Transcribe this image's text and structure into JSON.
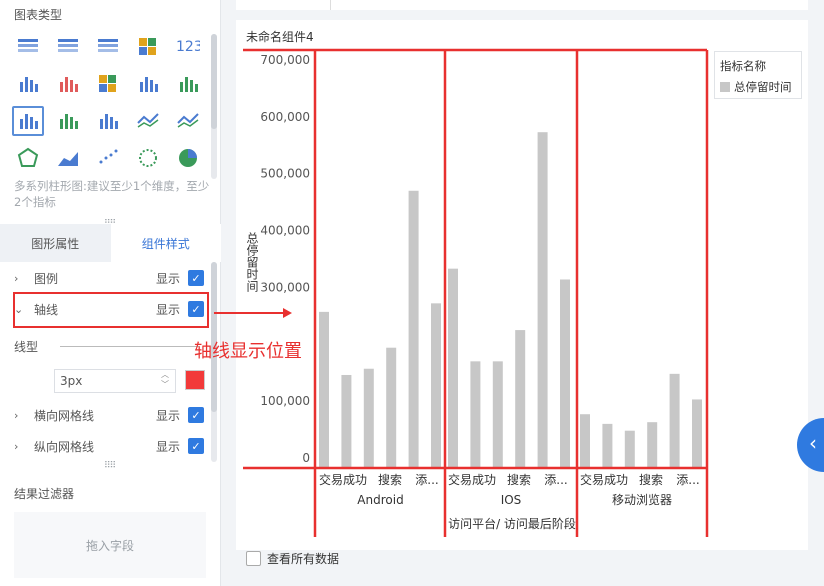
{
  "left": {
    "section_title": "图表类型",
    "chart_types": [
      {
        "name": "table-icon",
        "color": "#4a7bd0"
      },
      {
        "name": "group-table-icon",
        "color": "#4a7bd0"
      },
      {
        "name": "cross-table-icon",
        "color": "#4a7bd0"
      },
      {
        "name": "color-block-icon",
        "color": "#e0a31c"
      },
      {
        "name": "kpi-number-icon",
        "color": "#4a7bd0"
      },
      {
        "name": "multi-kpi-icon",
        "color": "#4a7bd0"
      },
      {
        "name": "kpi-grid-icon",
        "color": "#e05b5b"
      },
      {
        "name": "heatmap-icon",
        "color": "#e0a31c"
      },
      {
        "name": "stacked-bar-icon",
        "color": "#4a7bd0"
      },
      {
        "name": "bar-chart-icon",
        "color": "#3a9a5a"
      },
      {
        "name": "multi-series-bar-icon",
        "color": "#4a7bd0"
      },
      {
        "name": "horizontal-bar-icon",
        "color": "#3a9a5a"
      },
      {
        "name": "step-bar-icon",
        "color": "#4a7bd0"
      },
      {
        "name": "multi-line-icon",
        "color": "#4a7bd0"
      },
      {
        "name": "combo-line-icon",
        "color": "#4a7bd0"
      },
      {
        "name": "radar-icon",
        "color": "#3a9a5a"
      },
      {
        "name": "area-icon",
        "color": "#4a7bd0"
      },
      {
        "name": "scatter-icon",
        "color": "#4a7bd0"
      },
      {
        "name": "bubble-icon",
        "color": "#3a9a5a"
      },
      {
        "name": "pie-icon",
        "color": "#3a9a5a"
      }
    ],
    "hint": "多系列柱形图:建议至少1个维度，至少2个指标",
    "tabs": [
      "图形属性",
      "组件样式"
    ],
    "props": [
      {
        "label": "图例",
        "show": "显示"
      },
      {
        "label": "轴线",
        "show": "显示"
      },
      {
        "label": "横向网格线",
        "show": "显示"
      },
      {
        "label": "纵向网格线",
        "show": "显示"
      }
    ],
    "line_type_label": "线型",
    "size_value": "3px",
    "line_color": "#f23a3a",
    "filter_title": "结果过滤器",
    "filter_placeholder": "拖入字段"
  },
  "main": {
    "card_title": "未命名组件4",
    "legend_title": "指标名称",
    "legend_item": "总停留时间",
    "annotation": "轴线显示位置",
    "view_all_label": "查看所有数据",
    "accent": "#e8302f"
  },
  "chart_data": {
    "type": "bar",
    "ylabel": "总停留时间",
    "xlabel": "访问平台/ 访问最后阶段",
    "ylim": [
      0,
      700000
    ],
    "yticks": [
      "0",
      "100,000",
      "300,000",
      "400,000",
      "500,000",
      "600,000",
      "700,000"
    ],
    "ytick_values": [
      0,
      100000,
      300000,
      400000,
      500000,
      600000,
      700000
    ],
    "groups": [
      {
        "name": "Android",
        "tick_labels": [
          "交易成功",
          "搜索",
          "添..."
        ],
        "values": [
          257000,
          146000,
          157000,
          194000,
          470000,
          272000
        ]
      },
      {
        "name": "IOS",
        "tick_labels": [
          "交易成功",
          "搜索",
          "添..."
        ],
        "values": [
          333000,
          170000,
          170000,
          225000,
          573000,
          314000
        ]
      },
      {
        "name": "移动浏览器",
        "tick_labels": [
          "交易成功",
          "搜索",
          "添..."
        ],
        "values": [
          77000,
          60000,
          48000,
          63000,
          148000,
          103000
        ]
      }
    ],
    "series": [
      {
        "name": "总停留时间",
        "color": "#c7c7c7"
      }
    ]
  }
}
